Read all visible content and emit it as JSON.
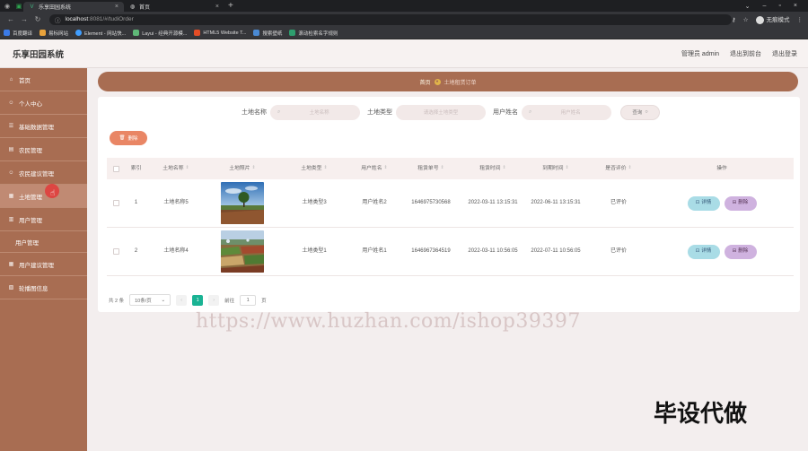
{
  "browser": {
    "tabs": [
      {
        "title": "乐享田园系统",
        "active": true
      },
      {
        "title": "首页",
        "active": false
      }
    ],
    "url_host": "localhost",
    "url_path": ":8081/#/tudiOrder",
    "profile_label": "无痕模式",
    "bookmarks": [
      {
        "label": "百度翻译",
        "color": "#3b7be8"
      },
      {
        "label": "易标网站",
        "color": "#e8a23b"
      },
      {
        "label": "Element - 网站快...",
        "color": "#409eff"
      },
      {
        "label": "Layui - 经典开源模...",
        "color": "#5fb878"
      },
      {
        "label": "HTML5 Website T...",
        "color": "#e44d26"
      },
      {
        "label": "搜索壁纸",
        "color": "#4a8ad4"
      },
      {
        "label": "滚动检索名字规则",
        "color": "#2e9e6e"
      }
    ]
  },
  "header": {
    "title": "乐享田园系统",
    "user": "管理员 admin",
    "exit_front": "退出到前台",
    "logout": "退出登录"
  },
  "sidebar": {
    "items": [
      {
        "label": "首页",
        "icon": "home-icon",
        "active": false
      },
      {
        "label": "个人中心",
        "icon": "user-icon",
        "active": false
      },
      {
        "label": "基础数据管理",
        "icon": "data-icon",
        "active": false
      },
      {
        "label": "农民管理",
        "icon": "farmer-icon",
        "active": false
      },
      {
        "label": "农民建议管理",
        "icon": "suggest-icon",
        "active": false
      },
      {
        "label": "土地管理",
        "icon": "land-icon",
        "active": true
      },
      {
        "label": "用户管理",
        "icon": "users-icon",
        "active": false
      }
    ],
    "sub_label": "用户管理",
    "items_after": [
      {
        "label": "用户建议管理",
        "icon": "feedback-icon"
      },
      {
        "label": "轮播图信息",
        "icon": "carousel-icon"
      }
    ]
  },
  "breadcrumb": {
    "home": "首页",
    "current": "土地租赁订单"
  },
  "search": {
    "fields": [
      {
        "label": "土地名称",
        "placeholder": "土地名称"
      },
      {
        "label": "土地类型",
        "placeholder": "请选择土地类型"
      },
      {
        "label": "用户姓名",
        "placeholder": "用户姓名"
      }
    ],
    "button": "查询"
  },
  "toolbar": {
    "delete_label": "删除"
  },
  "table": {
    "columns": [
      "索引",
      "土地名称",
      "土地照片",
      "土地类型",
      "用户姓名",
      "租赁单号",
      "租赁时间",
      "到期时间",
      "是否评价",
      "操作"
    ],
    "rows": [
      {
        "index": "1",
        "name": "土地名称5",
        "image": "green-field",
        "type": "土地类型3",
        "user": "用户姓名2",
        "order_no": "1646975730568",
        "start": "2022-03-11 13:15:31",
        "end": "2022-06-11 13:15:31",
        "rated": "已评价"
      },
      {
        "index": "2",
        "name": "土地名称4",
        "image": "farmland",
        "type": "土地类型1",
        "user": "用户姓名1",
        "order_no": "1646967364519",
        "start": "2022-03-11 10:56:05",
        "end": "2022-07-11 10:56:05",
        "rated": "已评价"
      }
    ],
    "detail_label": "详情",
    "delete_label": "删除"
  },
  "pagination": {
    "total": "共 2 条",
    "page_size": "10条/页",
    "current_page": "1",
    "goto_label": "前往",
    "goto_value": "1",
    "page_unit": "页"
  },
  "overlay": {
    "watermark": "https://www.huzhan.com/ishop39397",
    "stamp": "毕设代做"
  }
}
